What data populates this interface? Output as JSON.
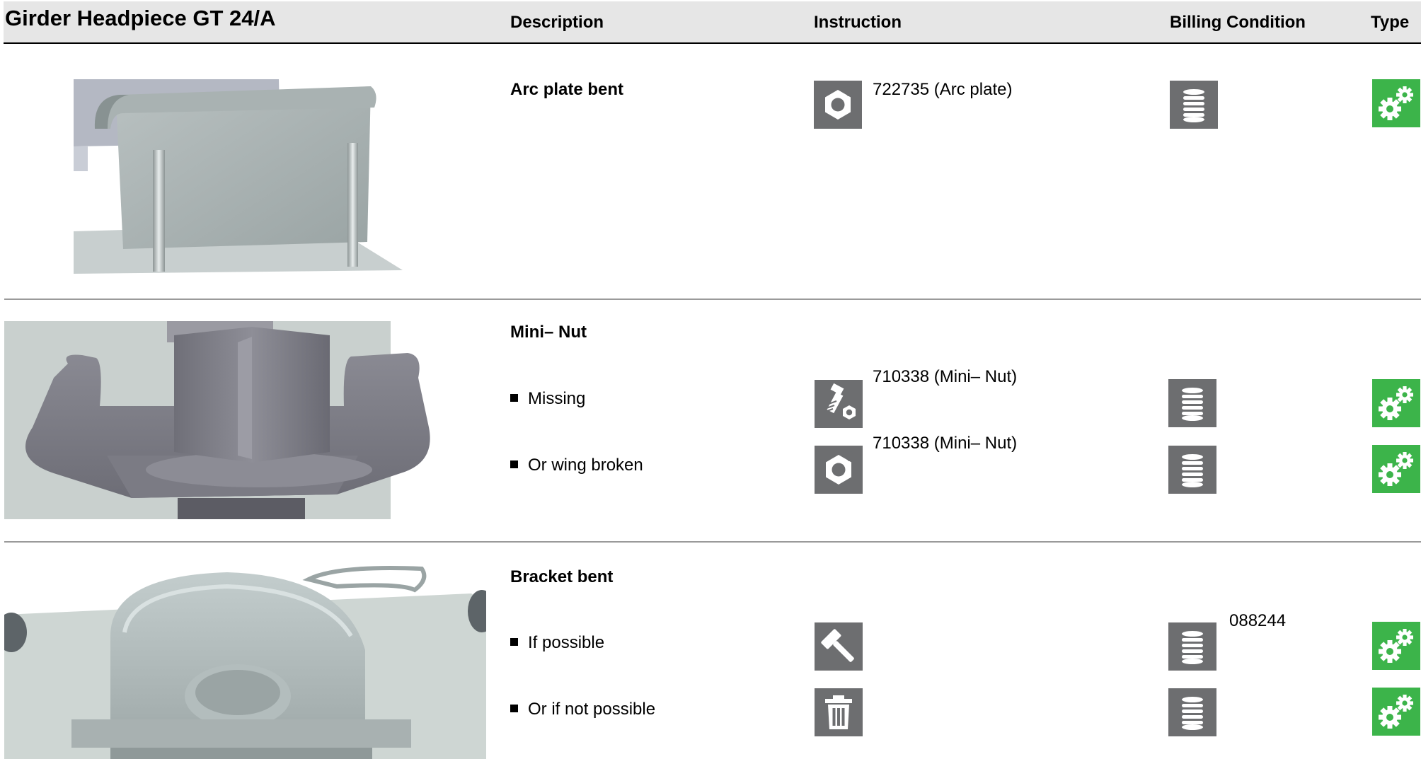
{
  "header": {
    "title": "Girder Headpiece GT 24/A",
    "columns": {
      "description": "Description",
      "instruction": "Instruction",
      "billing": "Billing Condition",
      "type": "Type"
    }
  },
  "rows": [
    {
      "title": "Arc plate bent",
      "image_icon": "arc-plate-render",
      "lines": [
        {
          "instruction_icon": "nut-replace-icon",
          "instruction_text": "722735 (Arc plate)",
          "billing_icon": "coin-stack-icon",
          "type_icon": "gears-icon"
        }
      ]
    },
    {
      "title": "Mini– Nut",
      "image_icon": "wing-nut-render",
      "lines": [
        {
          "bullet": "Missing",
          "instruction_icon": "bolt-nut-icon",
          "instruction_text": "710338 (Mini– Nut)",
          "billing_icon": "coin-stack-icon",
          "type_icon": "gears-icon"
        },
        {
          "bullet": "Or wing broken",
          "instruction_icon": "nut-replace-icon",
          "instruction_text": "710338 (Mini– Nut)",
          "billing_icon": "coin-stack-icon",
          "type_icon": "gears-icon"
        }
      ]
    },
    {
      "title": "Bracket bent",
      "image_icon": "bracket-render",
      "lines": [
        {
          "bullet": "If possible",
          "instruction_icon": "hammer-icon",
          "billing_icon": "coin-stack-icon",
          "billing_text": "088244",
          "type_icon": "gears-icon"
        },
        {
          "bullet": "Or if not possible",
          "instruction_icon": "trash-icon",
          "billing_icon": "coin-stack-icon",
          "type_icon": "gears-icon"
        }
      ]
    }
  ],
  "colors": {
    "icon_gray": "#6d6e70",
    "icon_green": "#3cb44a",
    "header_bg": "#e6e6e6",
    "separator": "#9a9a9a"
  }
}
